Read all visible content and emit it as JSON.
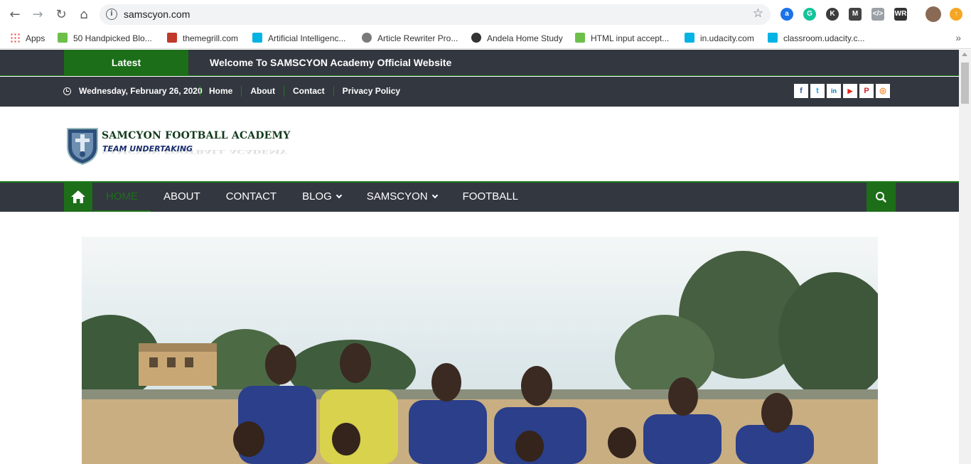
{
  "browser": {
    "url": "samscyon.com",
    "bookmarks": [
      {
        "label": "Apps",
        "icon": "apps-grid-icon",
        "color": "#e94235"
      },
      {
        "label": "50 Handpicked Blo...",
        "icon": "handpicked-icon",
        "color": "#6cc04a"
      },
      {
        "label": "themegrill.com",
        "icon": "themegrill-icon",
        "color": "#c0392b"
      },
      {
        "label": "Artificial Intelligenc...",
        "icon": "udacity-icon",
        "color": "#02b3e4"
      },
      {
        "label": "Article Rewriter Pro...",
        "icon": "seo-icon",
        "color": "#7a7a7a"
      },
      {
        "label": "Andela Home Study",
        "icon": "andela-icon",
        "color": "#333333"
      },
      {
        "label": "HTML input accept...",
        "icon": "html-icon",
        "color": "#6cc04a"
      },
      {
        "label": "in.udacity.com",
        "icon": "udacity-icon",
        "color": "#02b3e4"
      },
      {
        "label": "classroom.udacity.c...",
        "icon": "udacity-icon",
        "color": "#02b3e4"
      }
    ],
    "more": "»"
  },
  "page": {
    "latest_label": "Latest",
    "latest_text": "Welcome To SAMSCYON Academy Official Website",
    "date": "Wednesday, February 26, 2020",
    "top_links": [
      "Home",
      "About",
      "Contact",
      "Privacy Policy"
    ],
    "socials": [
      {
        "name": "facebook-icon",
        "glyph": "f",
        "color": "#3b5998"
      },
      {
        "name": "twitter-icon",
        "glyph": "t",
        "color": "#1da1f2"
      },
      {
        "name": "linkedin-icon",
        "glyph": "in",
        "color": "#0077b5"
      },
      {
        "name": "youtube-icon",
        "glyph": "▶",
        "color": "#e62117"
      },
      {
        "name": "pinterest-icon",
        "glyph": "P",
        "color": "#cb2027"
      },
      {
        "name": "instagram-icon",
        "glyph": "◎",
        "color": "#f58529"
      }
    ],
    "logo_title": "SAMCYON FOOTBALL ACADEMY",
    "logo_subtitle": "TEAM UNDERTAKING",
    "nav": [
      "HOME",
      "ABOUT",
      "CONTACT",
      "BLOG",
      "SAMSCYON",
      "FOOTBALL"
    ],
    "nav_dropdown": [
      false,
      false,
      false,
      true,
      true,
      false
    ],
    "colors": {
      "accent_green": "#1c6e18",
      "dark_bar": "#333740"
    }
  }
}
